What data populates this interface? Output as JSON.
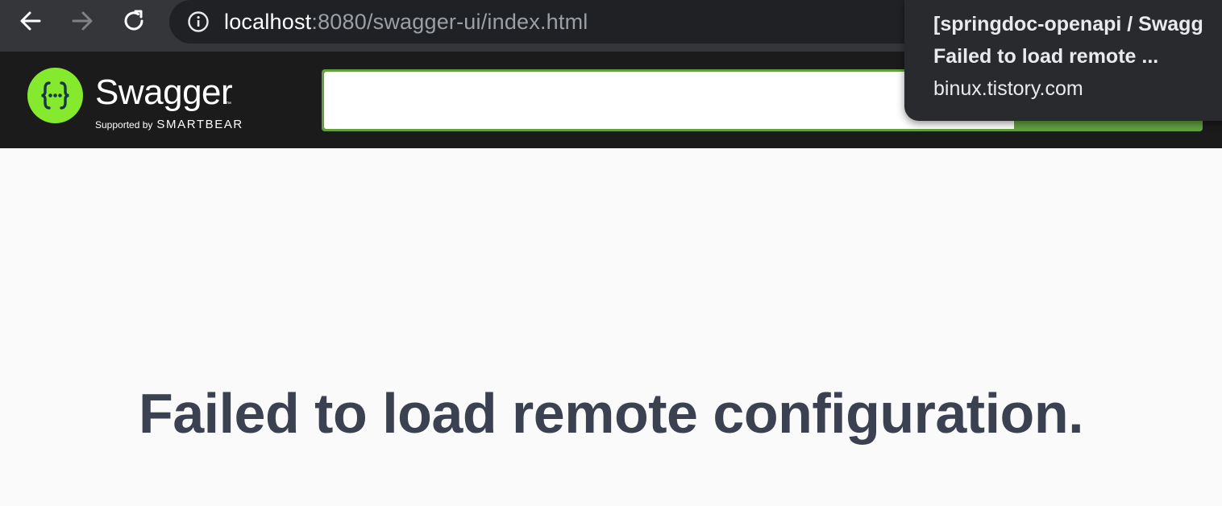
{
  "browser": {
    "url_host": "localhost",
    "url_path": ":8080/swagger-ui/index.html",
    "icons": {
      "back": "arrow-left-icon",
      "forward": "arrow-right-icon",
      "reload": "reload-icon",
      "site_info": "info-icon"
    }
  },
  "tooltip": {
    "title_line1": "[springdoc-openapi / Swagg",
    "title_line2": "Failed to load remote ...",
    "domain": "binux.tistory.com"
  },
  "swagger": {
    "logo_word": "Swagger",
    "logo_tm": "™",
    "supported_by": "Supported by",
    "brand": "SMARTBEAR",
    "explore_input_value": "",
    "explore_button_label": ""
  },
  "main": {
    "error_message": "Failed to load remote configuration."
  },
  "colors": {
    "browser_bg": "#35363a",
    "omnibox_bg": "#202124",
    "swagger_topbar": "#1b1b1b",
    "swagger_green": "#85ea2d",
    "explore_green": "#62a03f",
    "text_dark": "#3b4151",
    "page_bg": "#fafafa"
  }
}
